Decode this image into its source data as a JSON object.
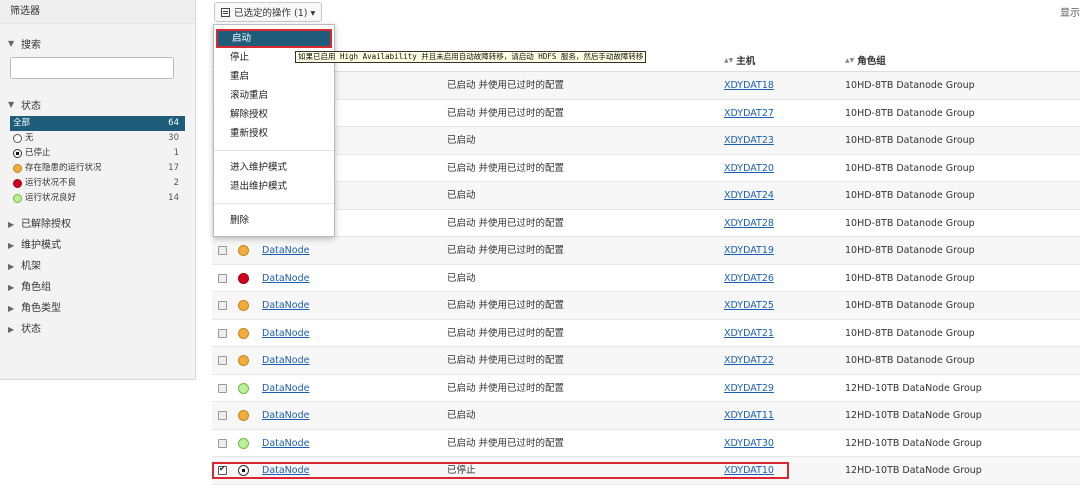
{
  "sidebar": {
    "title": "筛选器",
    "search_label": "搜索",
    "search_value": "",
    "status_label": "状态",
    "status_items": [
      {
        "label": "全部",
        "count": "64",
        "icon": "none"
      },
      {
        "label": "无",
        "count": "30",
        "icon": "empty-circle-icon"
      },
      {
        "label": "已停止",
        "count": "1",
        "icon": "stopped-icon"
      },
      {
        "label": "存在隐患的运行状况",
        "count": "17",
        "icon": "orange-circle-icon"
      },
      {
        "label": "运行状况不良",
        "count": "2",
        "icon": "red-circle-icon"
      },
      {
        "label": "运行状况良好",
        "count": "14",
        "icon": "green-circle-icon"
      }
    ],
    "collapsed_sections": [
      "已解除授权",
      "维护模式",
      "机架",
      "角色组",
      "角色类型",
      "状态"
    ]
  },
  "toolbar": {
    "selected_actions_label": "已选定的操作 (1) ▾",
    "display_label": "显示"
  },
  "dropdown": {
    "items": [
      "启动",
      "停止",
      "重启",
      "滚动重启",
      "解除授权",
      "重新授权"
    ],
    "items2": [
      "进入维护模式",
      "退出维护模式"
    ],
    "items3": [
      "删除"
    ],
    "tooltip": "如果已启用 High Availability 并且未启用自动故障转移，请启动 HDFS 服务，然后手动故障转移"
  },
  "table": {
    "header_host": "主机",
    "header_group": "角色组",
    "rows": [
      {
        "name": "",
        "state": "已启动 并使用已过时的配置",
        "host": "XDYDAT18",
        "group": "10HD-8TB Datanode Group",
        "status": "orange",
        "checked": false
      },
      {
        "name": "",
        "state": "已启动 并使用已过时的配置",
        "host": "XDYDAT27",
        "group": "10HD-8TB Datanode Group",
        "status": "orange",
        "checked": false
      },
      {
        "name": "",
        "state": "已启动",
        "host": "XDYDAT23",
        "group": "10HD-8TB Datanode Group",
        "status": "orange",
        "checked": false
      },
      {
        "name": "",
        "state": "已启动 并使用已过时的配置",
        "host": "XDYDAT20",
        "group": "10HD-8TB Datanode Group",
        "status": "orange",
        "checked": false
      },
      {
        "name": "",
        "state": "已启动",
        "host": "XDYDAT24",
        "group": "10HD-8TB Datanode Group",
        "status": "orange",
        "checked": false
      },
      {
        "name": "",
        "state": "已启动 并使用已过时的配置",
        "host": "XDYDAT28",
        "group": "10HD-8TB Datanode Group",
        "status": "orange",
        "checked": false
      },
      {
        "name": "DataNode",
        "state": "已启动 并使用已过时的配置",
        "host": "XDYDAT19",
        "group": "10HD-8TB Datanode Group",
        "status": "orange",
        "checked": false
      },
      {
        "name": "DataNode",
        "state": "已启动",
        "host": "XDYDAT26",
        "group": "10HD-8TB Datanode Group",
        "status": "red",
        "checked": false
      },
      {
        "name": "DataNode",
        "state": "已启动 并使用已过时的配置",
        "host": "XDYDAT25",
        "group": "10HD-8TB Datanode Group",
        "status": "orange",
        "checked": false
      },
      {
        "name": "DataNode",
        "state": "已启动 并使用已过时的配置",
        "host": "XDYDAT21",
        "group": "10HD-8TB Datanode Group",
        "status": "orange",
        "checked": false
      },
      {
        "name": "DataNode",
        "state": "已启动 并使用已过时的配置",
        "host": "XDYDAT22",
        "group": "10HD-8TB Datanode Group",
        "status": "orange",
        "checked": false
      },
      {
        "name": "DataNode",
        "state": "已启动 并使用已过时的配置",
        "host": "XDYDAT29",
        "group": "12HD-10TB DataNode Group",
        "status": "green",
        "checked": false
      },
      {
        "name": "DataNode",
        "state": "已启动",
        "host": "XDYDAT11",
        "group": "12HD-10TB DataNode Group",
        "status": "orange",
        "checked": false
      },
      {
        "name": "DataNode",
        "state": "已启动 并使用已过时的配置",
        "host": "XDYDAT30",
        "group": "12HD-10TB DataNode Group",
        "status": "green",
        "checked": false
      },
      {
        "name": "DataNode",
        "state": "已停止",
        "host": "XDYDAT10",
        "group": "12HD-10TB DataNode Group",
        "status": "stop",
        "checked": true
      }
    ]
  },
  "colors": {
    "accent": "#1f5c7a",
    "highlight": "#d9282f",
    "link": "#1a5fb4"
  }
}
